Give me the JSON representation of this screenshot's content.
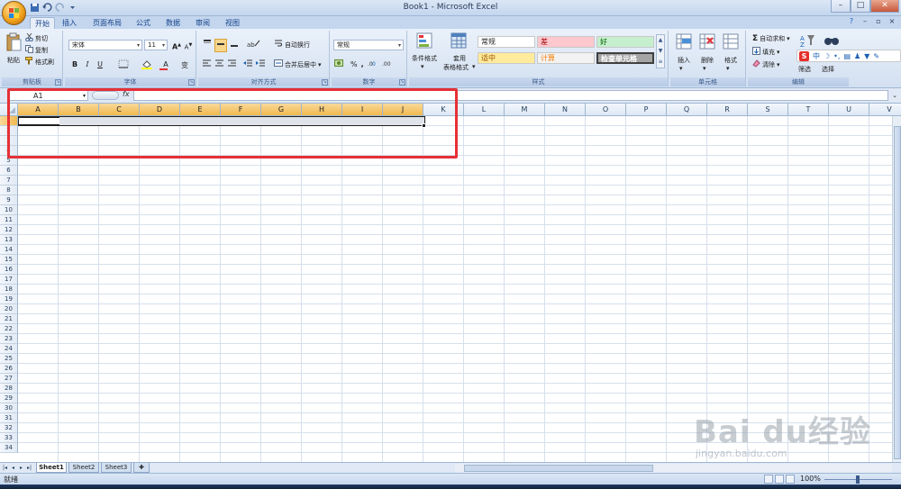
{
  "window": {
    "title": "Book1 - Microsoft Excel",
    "minimize": "–",
    "maximize": "□",
    "close": "✕"
  },
  "tabs": [
    "开始",
    "插入",
    "页面布局",
    "公式",
    "数据",
    "审阅",
    "视图"
  ],
  "active_tab": "开始",
  "ribbon": {
    "clipboard": {
      "label": "剪贴板",
      "paste": "粘贴",
      "cut": "剪切",
      "copy": "复制",
      "format_painter": "格式刷"
    },
    "font": {
      "label": "字体",
      "font_name": "宋体",
      "font_size": "11",
      "bold": "B",
      "italic": "I",
      "underline": "U"
    },
    "alignment": {
      "label": "对齐方式",
      "wrap_text": "自动换行",
      "merge_center": "合并后居中"
    },
    "number": {
      "label": "数字",
      "format": "常规",
      "percent": "%"
    },
    "styles": {
      "label": "样式",
      "conditional": "条件格式",
      "table_format_1": "套用",
      "table_format_2": "表格格式",
      "cells": [
        {
          "text": "常规",
          "bg": "#ffffff",
          "fg": "#1e1e1e"
        },
        {
          "text": "差",
          "bg": "#ffc7ce",
          "fg": "#9c0006"
        },
        {
          "text": "好",
          "bg": "#c6efce",
          "fg": "#006100"
        },
        {
          "text": "适中",
          "bg": "#ffeb9c",
          "fg": "#9c5700"
        },
        {
          "text": "计算",
          "bg": "#f2f2f2",
          "fg": "#fa7d00"
        },
        {
          "text": "检查单元格",
          "bg": "#a5a5a5",
          "fg": "#ffffff"
        }
      ]
    },
    "cells_group": {
      "label": "单元格",
      "insert": "插入",
      "delete": "删除",
      "format": "格式"
    },
    "editing": {
      "label": "编辑",
      "autosum": "自动求和",
      "fill": "填充",
      "clear": "清除",
      "sort_filter": "筛选",
      "find_select": "选择"
    }
  },
  "formula_bar": {
    "name_box": "A1",
    "fx": "fx",
    "content": ""
  },
  "columns": [
    "A",
    "B",
    "C",
    "D",
    "E",
    "F",
    "G",
    "H",
    "I",
    "J",
    "K",
    "L",
    "M",
    "N",
    "O",
    "P",
    "Q",
    "R",
    "S",
    "T",
    "U",
    "V"
  ],
  "rows": [
    "1",
    "2",
    "3",
    "4",
    "5",
    "6",
    "7",
    "8",
    "9",
    "10",
    "11",
    "12",
    "13",
    "14",
    "15",
    "16",
    "17",
    "18",
    "19",
    "20",
    "21",
    "22",
    "23",
    "24",
    "25",
    "26",
    "27",
    "28",
    "29",
    "30",
    "31",
    "32",
    "33",
    "34"
  ],
  "sheets": [
    "Sheet1",
    "Sheet2",
    "Sheet3"
  ],
  "active_sheet": "Sheet1",
  "status": {
    "ready": "就绪",
    "zoom": "100%"
  },
  "ime": {
    "logo": "S",
    "mode": "中"
  },
  "watermark": {
    "brand": "Bai du经验",
    "url": "jingyan.baidu.com"
  },
  "colors": {
    "accent": "#15428b",
    "highlight_box": "#e53036",
    "selected_header": "#f2b94f"
  }
}
